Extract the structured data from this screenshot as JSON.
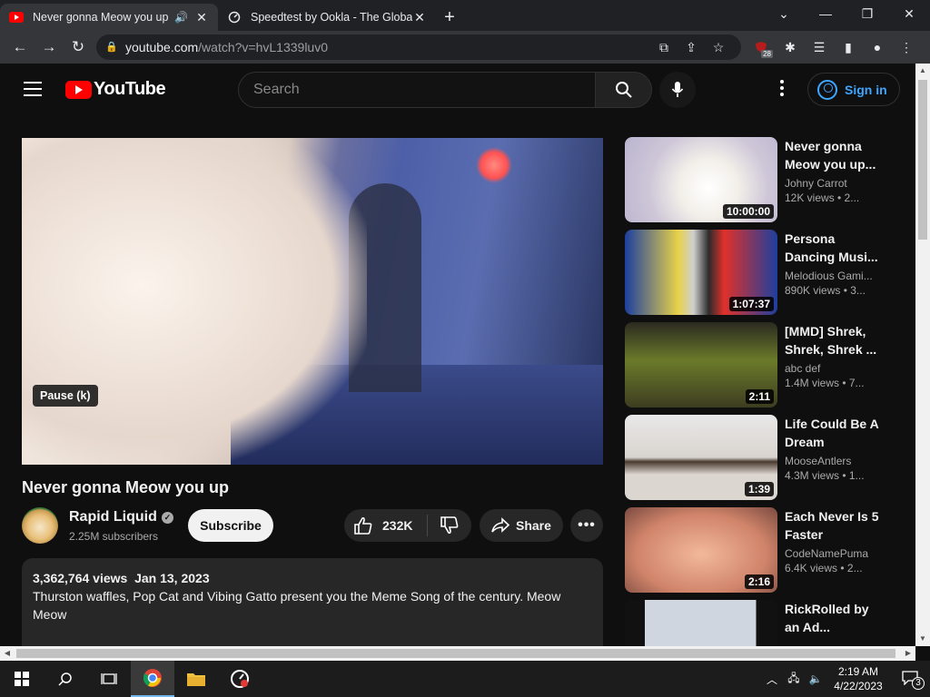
{
  "browser": {
    "tabs": [
      {
        "title": "Never gonna Meow you up",
        "active": true
      },
      {
        "title": "Speedtest by Ookla - The Global",
        "active": false
      }
    ],
    "url_host": "youtube.com",
    "url_path": "/watch?v=hvL1339luv0",
    "extension_badge": "28"
  },
  "youtube": {
    "logo_text": "YouTube",
    "search_placeholder": "Search",
    "signin_label": "Sign in",
    "player": {
      "tooltip": "Pause (k)"
    },
    "video": {
      "title": "Never gonna Meow you up",
      "channel": "Rapid Liquid",
      "subscribers": "2.25M subscribers",
      "subscribe_label": "Subscribe",
      "likes": "232K",
      "share_label": "Share",
      "more_label": "•••",
      "views": "3,362,764 views",
      "date": "Jan 13, 2023",
      "description": "Thurston waffles, Pop Cat and Vibing Gatto present you the Meme Song of the century. Meow Meow"
    },
    "recommendations": [
      {
        "title": "Never gonna Meow you up...",
        "channel": "Johny Carrot",
        "views": "12K views • 2...",
        "duration": "10:00:00"
      },
      {
        "title": "Persona Dancing Musi...",
        "channel": "Melodious Gami...",
        "views": "890K views • 3...",
        "duration": "1:07:37"
      },
      {
        "title": "[MMD] Shrek, Shrek, Shrek ...",
        "channel": "abc def",
        "views": "1.4M views • 7...",
        "duration": "2:11"
      },
      {
        "title": "Life Could Be A Dream",
        "channel": "MooseAntlers",
        "views": "4.3M views • 1...",
        "duration": "1:39"
      },
      {
        "title": "Each Never Is 5 Faster",
        "channel": "CodeNamePuma",
        "views": "6.4K views • 2...",
        "duration": "2:16"
      },
      {
        "title": "RickRolled by an Ad...",
        "channel": "",
        "views": "",
        "duration": ""
      }
    ]
  },
  "taskbar": {
    "time": "2:19 AM",
    "date": "4/22/2023",
    "notifications": "3"
  }
}
